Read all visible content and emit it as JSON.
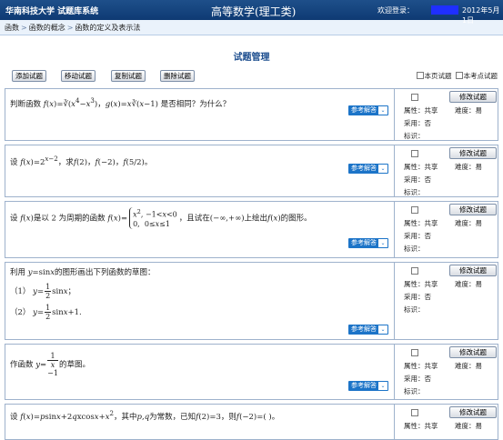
{
  "header": {
    "system": "华南科技大学 试题库系统",
    "course": "高等数学(理工类)",
    "welcome": "欢迎登录：",
    "date": "2012年5月1日"
  },
  "breadcrumb": [
    "函数",
    "函数的概念",
    "函数的定义及表示法"
  ],
  "page_title": "试题管理",
  "toolbar": {
    "add": "添加试题",
    "move": "移动试题",
    "copy": "复制试题",
    "delete": "删除试题",
    "filter_page": "本页试题",
    "filter_point": "本考点试题"
  },
  "common": {
    "answer_btn": "参考解答",
    "edit_btn": "修改试题",
    "attr_label": "属性：",
    "attr_value": "共享",
    "diff_label": "难度：",
    "diff_value": "易",
    "used_label": "采用：",
    "used_value": "否",
    "mark_label": "标识："
  },
  "questions": [
    {
      "text_a": "判断函数",
      "text_b": "，",
      "text_c": "是否相同？为什么？"
    },
    {
      "text_a": "设",
      "text_b": "，求",
      "text_c": "。"
    },
    {
      "text_a": "设",
      "text_b": "是以 2 为周期的函数",
      "text_c": "，且试在",
      "text_d": "上绘出",
      "text_e": "的图形。"
    },
    {
      "text_a": "利用",
      "text_b": "的图形画出下列函数的草图：",
      "item1": "（1）",
      "item2": "（2）"
    },
    {
      "text_a": "作函数",
      "text_b": "的草图。"
    },
    {
      "text_a": "设",
      "text_b": "，其中",
      "text_c": "为常数，已知",
      "text_d": "，则",
      "text_e": "。"
    }
  ]
}
